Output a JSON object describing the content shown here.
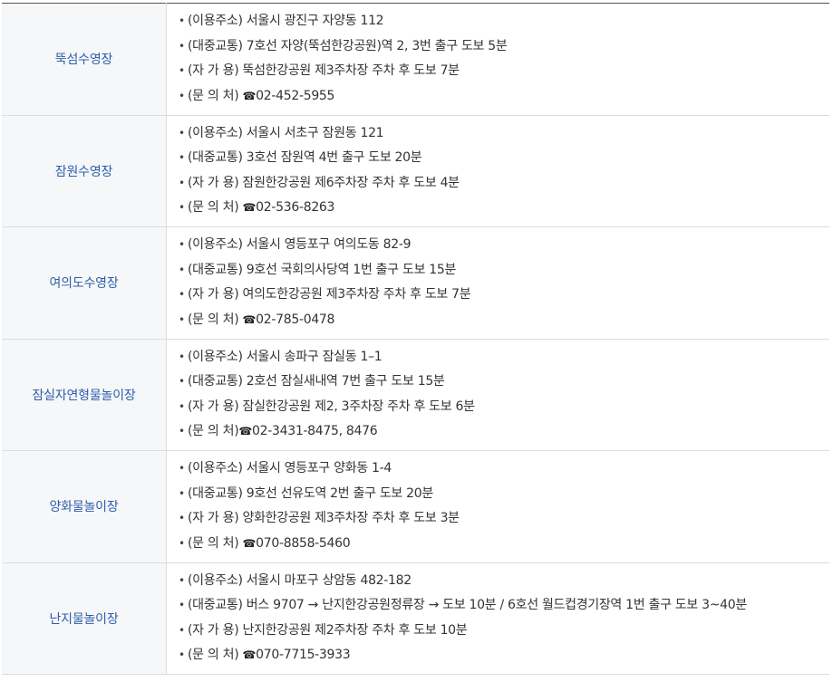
{
  "bullet": "•",
  "phone_icon": "☎",
  "rows": [
    {
      "name": "뚝섬수영장",
      "address": "(이용주소) 서울시 광진구 자양동 112",
      "transit": "(대중교통) 7호선 자양(뚝섬한강공원)역 2, 3번 출구 도보 5분",
      "parking": "(자 가 용) 뚝섬한강공원 제3주차장 주차 후 도보 7분",
      "contact_label": "(문 의 처) ",
      "contact_phone": "02-452-5955"
    },
    {
      "name": "잠원수영장",
      "address": "(이용주소) 서울시 서초구 잠원동 121",
      "transit": "(대중교통) 3호선 잠원역 4번 출구 도보 20분",
      "parking": "(자 가 용) 잠원한강공원 제6주차장 주차 후 도보 4분",
      "contact_label": "(문 의 처) ",
      "contact_phone": "02-536-8263"
    },
    {
      "name": "여의도수영장",
      "address": "(이용주소) 서울시 영등포구 여의도동 82-9",
      "transit": "(대중교통) 9호선 국회의사당역 1번 출구 도보 15분",
      "parking": "(자 가 용) 여의도한강공원 제3주차장 주차 후 도보 7분",
      "contact_label": "(문 의 처) ",
      "contact_phone": "02-785-0478"
    },
    {
      "name": "잠실자연형물놀이장",
      "address": "(이용주소) 서울시 송파구 잠실동 1–1",
      "transit": "(대중교통) 2호선 잠실새내역 7번 출구 도보 15분",
      "parking": "(자 가 용) 잠실한강공원 제2, 3주차장 주차 후 도보 6분",
      "contact_label": "(문 의 처)",
      "contact_phone": "02-3431-8475, 8476"
    },
    {
      "name": "양화물놀이장",
      "address": "(이용주소) 서울시 영등포구 양화동 1-4",
      "transit": "(대중교통) 9호선 선유도역 2번 출구 도보 20분",
      "parking": "(자 가 용) 양화한강공원 제3주차장 주차 후 도보 3분",
      "contact_label": "(문 의 처) ",
      "contact_phone": "070-8858-5460"
    },
    {
      "name": "난지물놀이장",
      "address": "(이용주소) 서울시 마포구 상암동 482-182",
      "transit": "(대중교통) 버스 9707 → 난지한강공원정류장 → 도보 10분 / 6호선 월드컵경기장역 1번 출구 도보 3~40분",
      "parking": "(자 가 용) 난지한강공원 제2주차장 주차 후 도보 10분",
      "contact_label": "(문 의 처) ",
      "contact_phone": "070-7715-3933"
    }
  ]
}
